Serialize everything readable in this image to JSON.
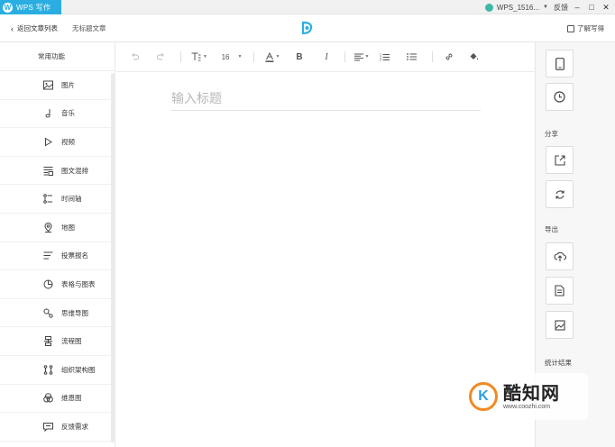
{
  "titlebar": {
    "app_title": "WPS 写作",
    "user_name": "WPS_1516...",
    "feedback": "反馈",
    "min": "–",
    "max": "□",
    "close": "✕"
  },
  "header": {
    "back_label": "返回文章列表",
    "doc_title": "无标题文章",
    "learn_label": "了解写得"
  },
  "sidebar": {
    "heading": "常用功能",
    "items": [
      {
        "label": "图片",
        "icon": "image-icon"
      },
      {
        "label": "音乐",
        "icon": "music-icon"
      },
      {
        "label": "视频",
        "icon": "video-icon"
      },
      {
        "label": "图文混排",
        "icon": "layout-icon"
      },
      {
        "label": "时间轴",
        "icon": "timeline-icon"
      },
      {
        "label": "地图",
        "icon": "map-pin-icon"
      },
      {
        "label": "投票报名",
        "icon": "vote-icon"
      },
      {
        "label": "表格与图表",
        "icon": "chart-icon"
      },
      {
        "label": "思维导图",
        "icon": "mindmap-icon"
      },
      {
        "label": "流程图",
        "icon": "flowchart-icon"
      },
      {
        "label": "组织架构图",
        "icon": "org-chart-icon"
      },
      {
        "label": "维恩图",
        "icon": "venn-icon"
      },
      {
        "label": "反馈需求",
        "icon": "feedback-icon"
      }
    ]
  },
  "toolbar": {
    "font_size": "16"
  },
  "editor": {
    "title_placeholder": "输入标题",
    "title_value": ""
  },
  "rightpanel": {
    "share_label": "分享",
    "export_label": "导出",
    "stats_label": "统计结果"
  },
  "watermark": {
    "logo_letter": "K",
    "brand": "酷知网",
    "url": "www.coozhi.com"
  },
  "colors": {
    "brand": "#2aaee2",
    "watermark_orange": "#f08a23"
  }
}
